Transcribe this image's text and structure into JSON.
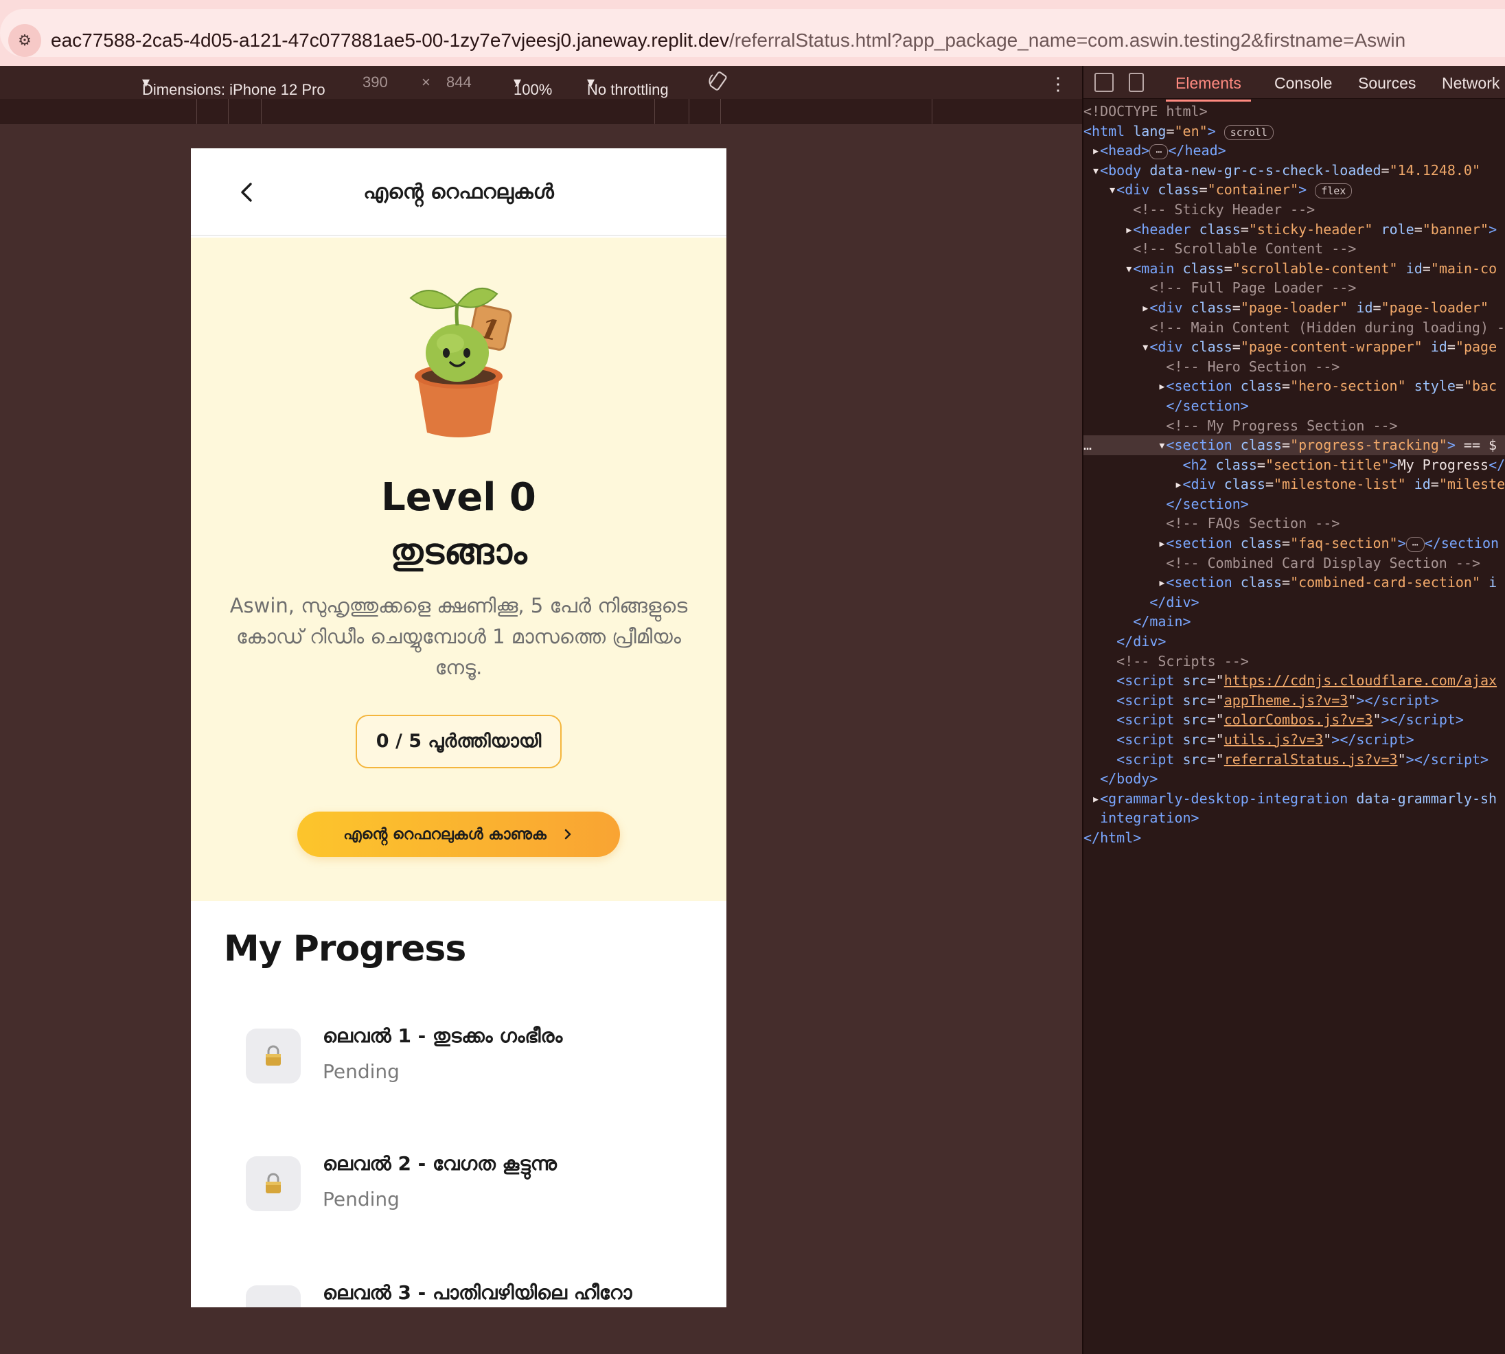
{
  "browser": {
    "url_host": "eac77588-2ca5-4d05-a121-47c077881ae5-00-1zy7e7vjeesj0.janeway.replit.dev",
    "url_rest": "/referralStatus.html?app_package_name=com.aswin.testing2&firstname=Aswin"
  },
  "device_toolbar": {
    "dimensions_label": "Dimensions: iPhone 12 Pro",
    "width": "390",
    "times": "×",
    "height": "844",
    "zoom": "100%",
    "throttling": "No throttling"
  },
  "devtools": {
    "tabs": [
      "Elements",
      "Console",
      "Sources",
      "Network"
    ],
    "active_tab": "Elements"
  },
  "app": {
    "header_title": "എൻ്റെ റെഫറലുകൾ",
    "level_title": "Level 0",
    "level_subtitle": "തുടങ്ങാം",
    "description": "Aswin, സുഹൃത്തുക്കളെ ക്ഷണിക്കൂ, 5 പേർ നിങ്ങളുടെ കോഡ് റിഡീം ചെയ്യുമ്പോൾ 1 മാസത്തെ പ്രീമിയം നേടൂ.",
    "progress_label": "0 / 5 പൂർത്തിയായി",
    "cta_label": "എൻ്റെ റെഫറലുകൾ കാണുക",
    "mascot_badge": "1",
    "section_title": "My Progress",
    "milestones": [
      {
        "title": "ലെവൽ 1 - തുടക്കം ഗംഭീരം",
        "status": "Pending"
      },
      {
        "title": "ലെവൽ 2 - വേഗത കൂട്ടുന്നു",
        "status": "Pending"
      },
      {
        "title": "ലെവൽ 3 - പാതിവഴിയിലെ ഹീറോ",
        "status": ""
      }
    ]
  },
  "code_lines": [
    {
      "html": "<span class=\"t-com\">&lt;!DOCTYPE html&gt;</span>"
    },
    {
      "html": "<span class=\"t-tag\">&lt;html</span> <span class=\"t-attr\">lang</span>=<span class=\"t-val\">\"en\"</span><span class=\"t-tag\">&gt;</span> <span class=\"badge\">scroll</span>"
    },
    {
      "html": " ▸<span class=\"t-tag\">&lt;head&gt;</span><span class=\"badge\">⋯</span><span class=\"t-tag\">&lt;/head&gt;</span>"
    },
    {
      "html": " ▾<span class=\"t-tag\">&lt;body</span> <span class=\"t-attr\">data-new-gr-c-s-check-loaded</span>=<span class=\"t-val\">\"14.1248.0\"</span>"
    },
    {
      "html": "   ▾<span class=\"t-tag\">&lt;div</span> <span class=\"t-attr\">class</span>=<span class=\"t-val\">\"container\"</span><span class=\"t-tag\">&gt;</span> <span class=\"badge\">flex</span>"
    },
    {
      "html": "      <span class=\"t-com\">&lt;!-- Sticky Header --&gt;</span>"
    },
    {
      "html": "     ▸<span class=\"t-tag\">&lt;header</span> <span class=\"t-attr\">class</span>=<span class=\"t-val\">\"sticky-header\"</span> <span class=\"t-attr\">role</span>=<span class=\"t-val\">\"banner\"</span><span class=\"t-tag\">&gt;</span>"
    },
    {
      "html": "      <span class=\"t-com\">&lt;!-- Scrollable Content --&gt;</span>"
    },
    {
      "html": "     ▾<span class=\"t-tag\">&lt;main</span> <span class=\"t-attr\">class</span>=<span class=\"t-val\">\"scrollable-content\"</span> <span class=\"t-attr\">id</span>=<span class=\"t-val\">\"main-co</span>"
    },
    {
      "html": "        <span class=\"t-com\">&lt;!-- Full Page Loader --&gt;</span>"
    },
    {
      "html": "       ▸<span class=\"t-tag\">&lt;div</span> <span class=\"t-attr\">class</span>=<span class=\"t-val\">\"page-loader\"</span> <span class=\"t-attr\">id</span>=<span class=\"t-val\">\"page-loader\"</span>"
    },
    {
      "html": "        <span class=\"t-com\">&lt;!-- Main Content (Hidden during loading) -</span>"
    },
    {
      "html": "       ▾<span class=\"t-tag\">&lt;div</span> <span class=\"t-attr\">class</span>=<span class=\"t-val\">\"page-content-wrapper\"</span> <span class=\"t-attr\">id</span>=<span class=\"t-val\">\"page</span>"
    },
    {
      "html": "          <span class=\"t-com\">&lt;!-- Hero Section --&gt;</span>"
    },
    {
      "html": "         ▸<span class=\"t-tag\">&lt;section</span> <span class=\"t-attr\">class</span>=<span class=\"t-val\">\"hero-section\"</span> <span class=\"t-attr\">style</span>=<span class=\"t-val\">\"bac</span>"
    },
    {
      "html": "          <span class=\"t-tag\">&lt;/section&gt;</span>"
    },
    {
      "html": "          <span class=\"t-com\">&lt;!-- My Progress Section --&gt;</span>"
    },
    {
      "html": "…        ▾<span class=\"t-tag\">&lt;section</span> <span class=\"t-attr\">class</span>=<span class=\"t-val\">\"progress-tracking\"</span><span class=\"t-tag\">&gt;</span> == $",
      "sel": true
    },
    {
      "html": "            <span class=\"t-tag\">&lt;h2</span> <span class=\"t-attr\">class</span>=<span class=\"t-val\">\"section-title\"</span><span class=\"t-tag\">&gt;</span>My Progress<span class=\"t-tag\">&lt;/</span>"
    },
    {
      "html": "           ▸<span class=\"t-tag\">&lt;div</span> <span class=\"t-attr\">class</span>=<span class=\"t-val\">\"milestone-list\"</span> <span class=\"t-attr\">id</span>=<span class=\"t-val\">\"mileste</span>"
    },
    {
      "html": "          <span class=\"t-tag\">&lt;/section&gt;</span>"
    },
    {
      "html": "          <span class=\"t-com\">&lt;!-- FAQs Section --&gt;</span>"
    },
    {
      "html": "         ▸<span class=\"t-tag\">&lt;section</span> <span class=\"t-attr\">class</span>=<span class=\"t-val\">\"faq-section\"</span><span class=\"t-tag\">&gt;</span><span class=\"badge\">⋯</span><span class=\"t-tag\">&lt;/section</span>"
    },
    {
      "html": "          <span class=\"t-com\">&lt;!-- Combined Card Display Section --&gt;</span>"
    },
    {
      "html": "         ▸<span class=\"t-tag\">&lt;section</span> <span class=\"t-attr\">class</span>=<span class=\"t-val\">\"combined-card-section\"</span> <span class=\"t-attr\">i</span>"
    },
    {
      "html": "        <span class=\"t-tag\">&lt;/div&gt;</span>"
    },
    {
      "html": "      <span class=\"t-tag\">&lt;/main&gt;</span>"
    },
    {
      "html": "    <span class=\"t-tag\">&lt;/div&gt;</span>"
    },
    {
      "html": "    <span class=\"t-com\">&lt;!-- Scripts --&gt;</span>"
    },
    {
      "html": "    <span class=\"t-tag\">&lt;script</span> <span class=\"t-attr\">src</span>=\"<span class=\"t-link\">https://cdnjs.cloudflare.com/ajax</span>"
    },
    {
      "html": "    <span class=\"t-tag\">&lt;script</span> <span class=\"t-attr\">src</span>=\"<span class=\"t-link\">appTheme.js?v=3</span>\"<span class=\"t-tag\">&gt;&lt;/script&gt;</span>"
    },
    {
      "html": "    <span class=\"t-tag\">&lt;script</span> <span class=\"t-attr\">src</span>=\"<span class=\"t-link\">colorCombos.js?v=3</span>\"<span class=\"t-tag\">&gt;&lt;/script&gt;</span>"
    },
    {
      "html": "    <span class=\"t-tag\">&lt;script</span> <span class=\"t-attr\">src</span>=\"<span class=\"t-link\">utils.js?v=3</span>\"<span class=\"t-tag\">&gt;&lt;/script&gt;</span>"
    },
    {
      "html": "    <span class=\"t-tag\">&lt;script</span> <span class=\"t-attr\">src</span>=\"<span class=\"t-link\">referralStatus.js?v=3</span>\"<span class=\"t-tag\">&gt;&lt;/script&gt;</span>"
    },
    {
      "html": "  <span class=\"t-tag\">&lt;/body&gt;</span>"
    },
    {
      "html": " ▸<span class=\"t-tag\">&lt;grammarly-desktop-integration</span> <span class=\"t-attr\">data-grammarly-sh</span>"
    },
    {
      "html": "  <span class=\"t-tag\">integration&gt;</span>"
    },
    {
      "html": "<span class=\"t-tag\">&lt;/html&gt;</span>"
    }
  ]
}
